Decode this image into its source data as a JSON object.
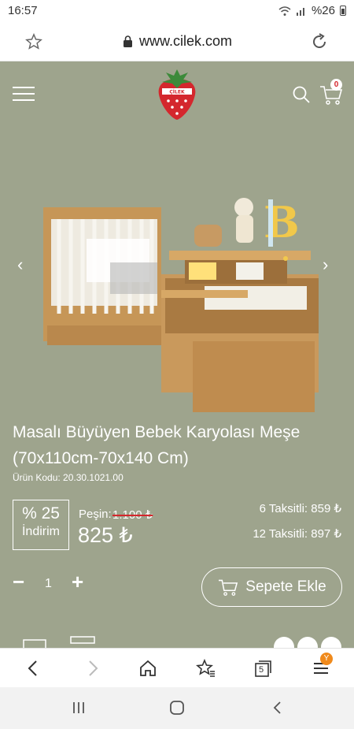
{
  "status_bar": {
    "time": "16:57",
    "battery": "%26"
  },
  "browser": {
    "url": "www.cilek.com",
    "tabs_count": "5",
    "menu_badge": "Y"
  },
  "header": {
    "cart_count": "0"
  },
  "product": {
    "title": "Masalı Büyüyen Bebek Karyolası Meşe (70x110cm-70x140 Cm)",
    "code": "Ürün Kodu: 20.30.1021.00",
    "discount_percent": "% 25",
    "discount_label": "İndirim",
    "cash_label": "Peşin:",
    "old_price": "1.100 ₺",
    "price": "825 ₺",
    "installment_6": "6 Taksitli: 859 ₺",
    "installment_12": "12 Taksitli: 897 ₺",
    "quantity": "1",
    "add_to_cart_label": "Sepete Ekle"
  },
  "colors": {
    "page_bg": "#9ea48d",
    "brand_red": "#d4272d",
    "badge_orange": "#f08a1c"
  }
}
